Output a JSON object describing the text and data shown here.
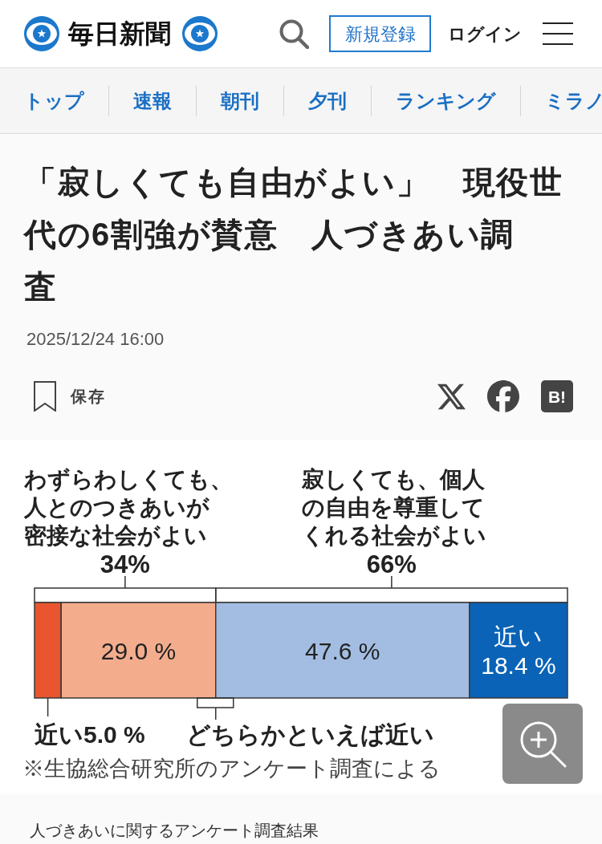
{
  "header": {
    "logo": "毎日新聞",
    "register_button": "新規登録",
    "login_link": "ログイン"
  },
  "nav_tabs": [
    {
      "label": "トップ"
    },
    {
      "label": "速報"
    },
    {
      "label": "朝刊"
    },
    {
      "label": "夕刊"
    },
    {
      "label": "ランキング"
    },
    {
      "label": "ミラノ"
    }
  ],
  "article": {
    "title": "「寂しくても自由がよい」　現役世代の6割強が賛意　人づきあい調査",
    "date": "2025/12/24 16:00",
    "save_button": "保存",
    "share_buttons": [
      {
        "kind": "x"
      },
      {
        "kind": "facebook"
      },
      {
        "kind": "hatena",
        "label": "B!"
      }
    ]
  },
  "infographic": {
    "groups": [
      {
        "label": "わずらわしくても、人とのつきあいが密接な社会がよい",
        "percent": "34%"
      },
      {
        "label": "寂しくても、個人の自由を尊重してくれる社会がよい",
        "percent": "66%"
      }
    ],
    "chart_data": {
      "type": "bar",
      "orientation": "horizontal",
      "stacked": true,
      "legend": "bottom",
      "series": [
        {
          "color": "#e8552f",
          "values": [
            5.0
          ],
          "value_labels": [
            "近い5.0 %"
          ]
        },
        {
          "name": "どちらかといえば近い",
          "color": "#f3ad8d",
          "values": [
            29.0
          ],
          "value_labels": [
            "29.0 %"
          ]
        },
        {
          "color": "#a3bde2",
          "values": [
            47.6
          ],
          "value_labels": [
            "47.6 %"
          ]
        },
        {
          "name": "近い",
          "color": "#0a63b6",
          "values": [
            18.4
          ],
          "value_labels": [
            "18.4 %"
          ]
        }
      ]
    },
    "note": "※生協総合研究所のアンケート調査による"
  },
  "caption": "人づきあいに関するアンケート調査結果"
}
